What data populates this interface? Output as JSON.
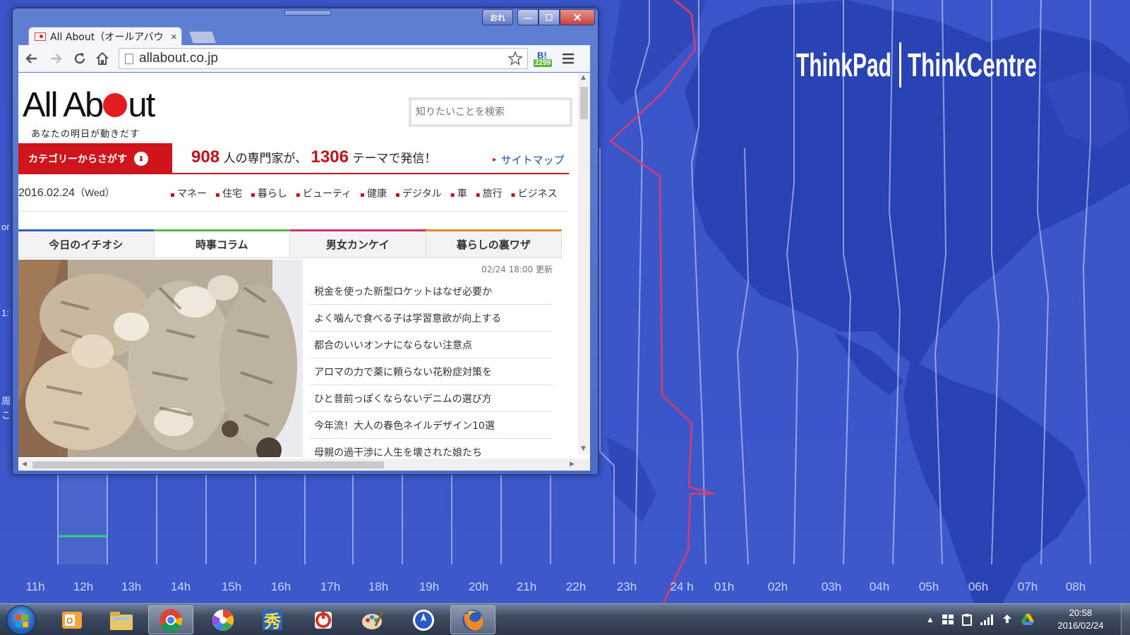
{
  "desktop": {
    "timezones": [
      "11h",
      "12h",
      "13h",
      "14h",
      "15h",
      "16h",
      "17h",
      "18h",
      "19h",
      "20h",
      "21h",
      "22h",
      "23h",
      "24 h",
      "01h",
      "02h",
      "03h",
      "04h",
      "05h",
      "06h",
      "07h",
      "08h"
    ],
    "brand_left": "ThinkPad",
    "brand_right": "ThinkCentre",
    "edge_texts": [
      "or",
      "1:",
      "周",
      "こ"
    ],
    "colors": {
      "ocean": "#3a55c9",
      "land": "#2a43b4",
      "dateline": "#d83b6e"
    }
  },
  "browser": {
    "caption": {
      "user_label": "おれ",
      "minimize": "—",
      "maximize": "☐",
      "close": "✕"
    },
    "tab": {
      "title": "All About（オールアバウ",
      "close": "×"
    },
    "url": "allabout.co.jp",
    "extension": {
      "label": "B!",
      "count": "2299"
    },
    "page": {
      "logo": {
        "prefix": "All Ab",
        "suffix": "ut"
      },
      "tagline": "あなたの明日が動きだす",
      "search_placeholder": "知りたいことを検索",
      "category_button": "カテゴリーからさがす",
      "headline": {
        "experts": "908",
        "mid": "人の専門家が、",
        "themes": "1306",
        "end": "テーマで発信！"
      },
      "sitemap": "サイトマップ",
      "date": "2016.02.24",
      "weekday": "（Wed）",
      "nav": [
        "マネー",
        "住宅",
        "暮らし",
        "ビューティ",
        "健康",
        "デジタル",
        "車",
        "旅行",
        "ビジネス"
      ],
      "tabs": [
        "今日のイチオシ",
        "時事コラム",
        "男女カンケイ",
        "暮らしの裏ワザ"
      ],
      "updated": "02/24 18:00 更新",
      "news": [
        "税金を使った新型ロケットはなぜ必要か",
        "よく噛んで食べる子は学習意欲が向上する",
        "都合のいいオンナにならない注意点",
        "アロマの力で薬に頼らない花粉症対策を",
        "ひと昔前っぽくならないデニムの選び方",
        "今年流！大人の春色ネイルデザイン10選",
        "母親の過干渉に人生を壊された娘たち"
      ]
    }
  },
  "taskbar": {
    "apps": [
      "outlook-icon",
      "file-explorer-icon",
      "chrome-icon",
      "picasa-icon",
      "hidemaru-icon",
      "antivirus-icon",
      "paint-icon",
      "navigator-icon",
      "firefox-icon"
    ],
    "clock_time": "20:58",
    "clock_date": "2016/02/24"
  }
}
